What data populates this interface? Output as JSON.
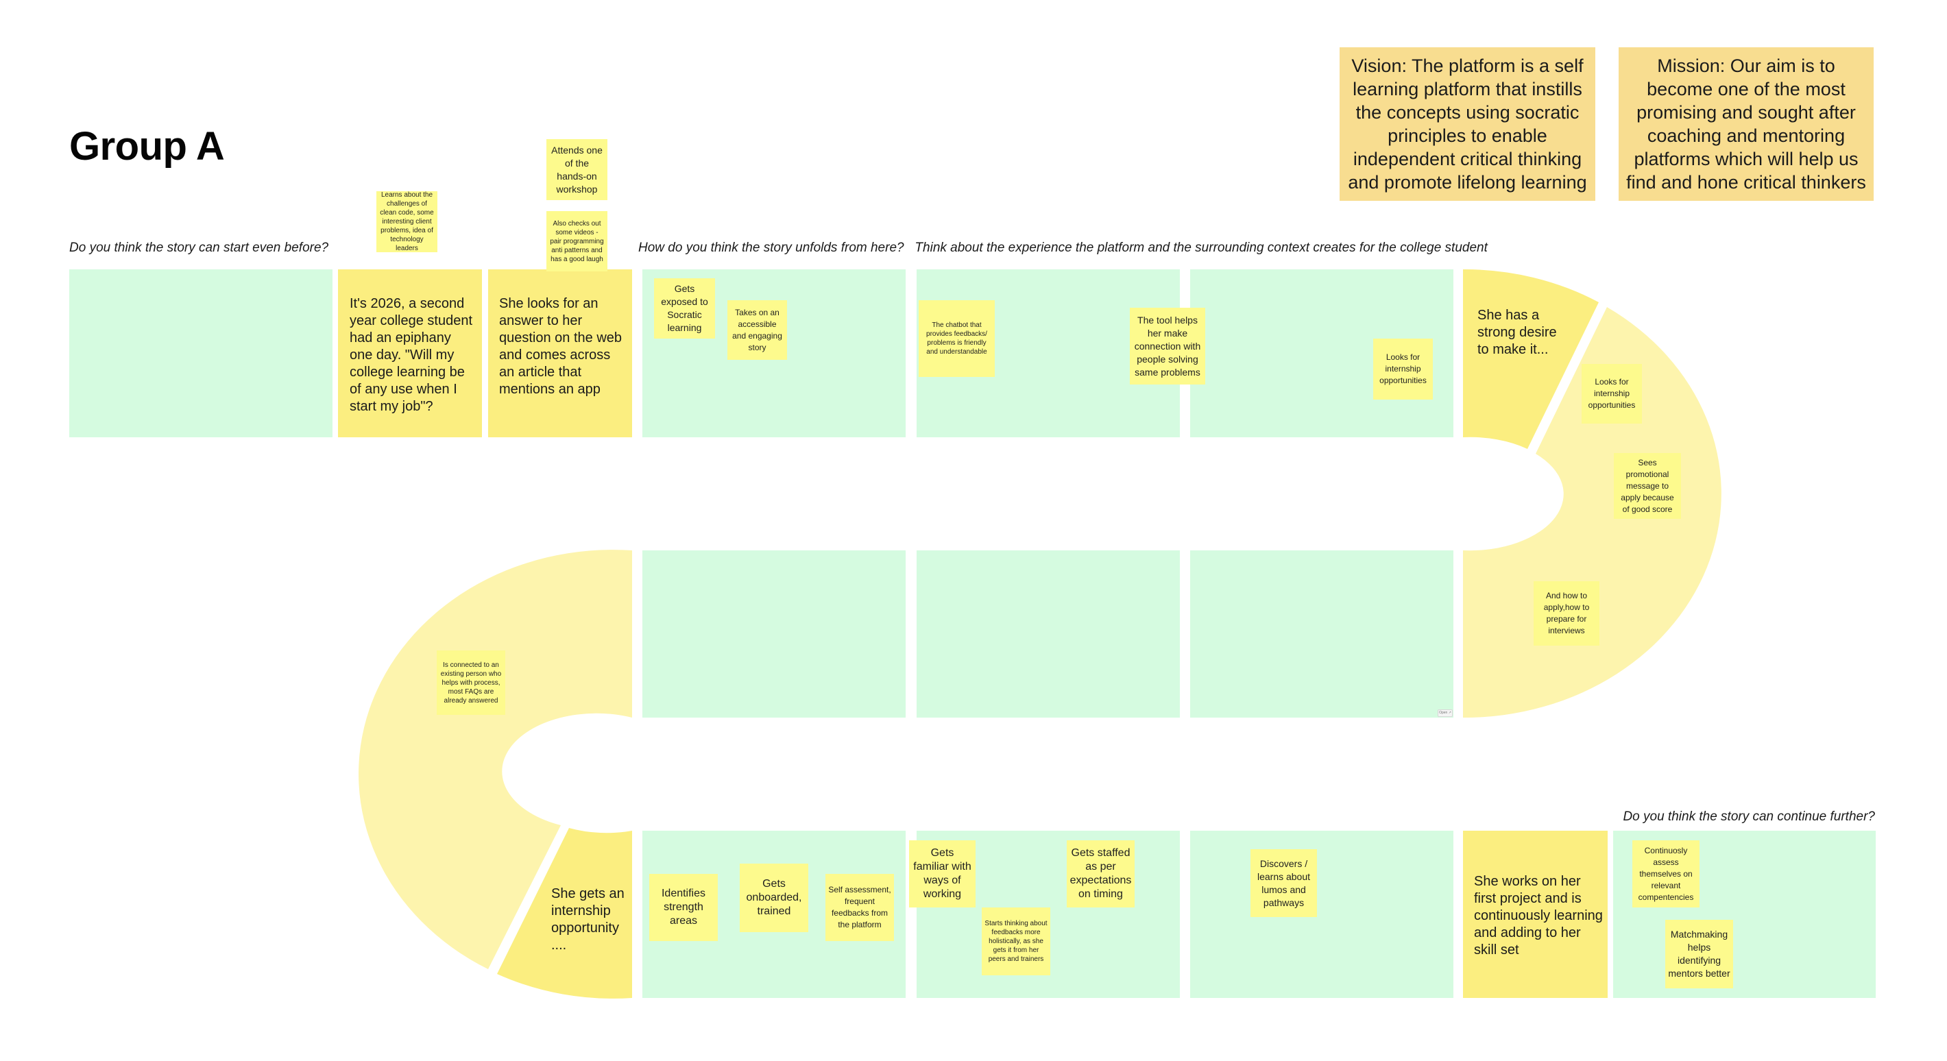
{
  "title": "Group A",
  "captions": {
    "start": "Do you think the story can start even before?",
    "unfold": "How do you think the story unfolds from here?   Think about the experience the platform and the surrounding context creates for the college student",
    "continue": "Do you think the story can continue further?"
  },
  "vision": "Vision:  The platform is a self learning platform that instills the concepts using socratic principles to enable independent critical thinking and promote lifelong learning",
  "mission": "Mission: Our aim is to become one of the most promising and sought after coaching and mentoring platforms which will help us find and hone critical thinkers",
  "story_cells": {
    "epiphany": "It's 2026, a second year college student had an epiphany one day. \"Will my college learning be of any use when I start my job\"?",
    "looks_for_answer": "She looks for an answer to her question on the web and comes across an article that mentions an app",
    "strong_desire": "She has a strong desire to make it...",
    "internship": "She gets an internship opportunity ....",
    "first_project": "She works on her first project and is continuously learning and adding to her skill set"
  },
  "stickies": {
    "learns_about": "Learns about the challenges of clean code, some interesting client problems, idea of technology leaders",
    "attends_workshop": "Attends one of the hands-on workshop",
    "checks_videos": "Also checks out some videos - pair programming anti patterns and has a good laugh",
    "socratic": "Gets exposed to Socratic learning",
    "engaging_story": "Takes on an accessible and engaging story",
    "chatbot": "The chatbot that provides feedbacks/ problems is friendly and understandable",
    "tool_helps": "The tool helps her make connection with people solving same problems",
    "looks_internship_1": "Looks for internship opportunities",
    "looks_internship_2": "Looks for internship opportunities",
    "promotional": "Sees promotional message to apply because of good score",
    "how_to_apply": "And how to apply,how to prepare for interviews",
    "connected_person": "Is connected to an existing person who helps with process, most FAQs are already answered",
    "strength_areas": "Identifies strength areas",
    "onboarded": "Gets onboarded, trained",
    "self_assessment": "Self assessment, frequent feedbacks from the platform",
    "ways_of_working": "Gets familiar with ways of working",
    "holistic_feedback": "Starts thinking about feedbacks more holistically, as she gets it from her peers and trainers",
    "staffed": "Gets staffed as per expectations on timing",
    "discovers_lumos": "Discovers / learns about lumos and pathways",
    "continuously_assess": "Continuosly assess themselves on relevant compentencies",
    "matchmaking": "Matchmaking helps identifying mentors better"
  },
  "open_button": "Open ↗",
  "colors": {
    "green_cell": "#d5fbe0",
    "yellow_cell": "#fbee80",
    "curve_light": "#fdf4ad",
    "sticky": "#fdfa8d",
    "vision_mission": "#f8dd90"
  }
}
